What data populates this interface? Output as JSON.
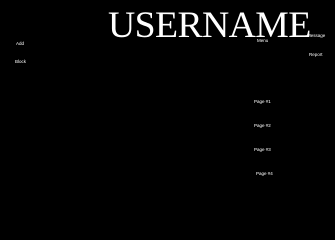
{
  "header": {
    "title": "USERNAME"
  },
  "actions": {
    "add_label": "Add",
    "block_label": "Block",
    "menu_label": "Menu",
    "message_label": "Message",
    "report_label": "Report"
  },
  "pages": [
    {
      "label": "Page #1"
    },
    {
      "label": "Page #2"
    },
    {
      "label": "Page #3"
    },
    {
      "label": "Page #4"
    }
  ],
  "colors": {
    "background": "#000000",
    "text": "#ffffff"
  }
}
